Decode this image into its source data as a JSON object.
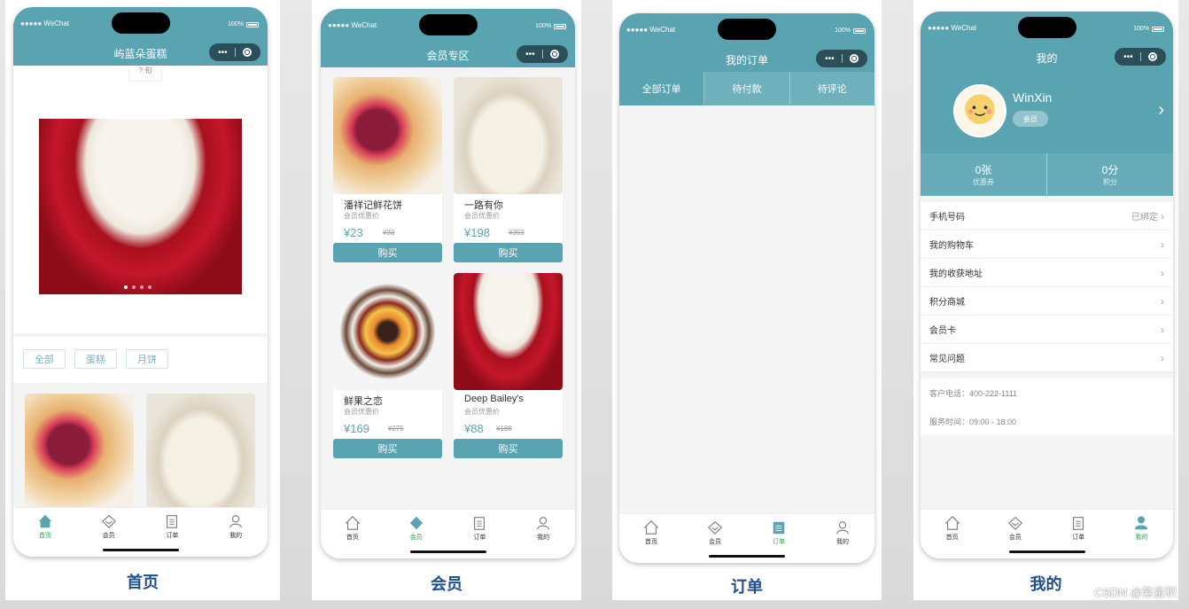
{
  "status": {
    "carrier": "●●●●● WeChat",
    "battery": "100%"
  },
  "tabs": {
    "home": "首页",
    "member": "会员",
    "order": "订单",
    "mine": "我的"
  },
  "home": {
    "title": "屿蓝朵蛋糕",
    "top_fragment": "? 旬",
    "filters": [
      "全部",
      "蛋糕",
      "月饼"
    ],
    "caption": "首页"
  },
  "member": {
    "title": "会员专区",
    "caption": "会员",
    "products": [
      {
        "name": "潘祥记鲜花饼",
        "sub": "会员优惠价",
        "price": "¥23",
        "orig": "¥33",
        "buy": "购买"
      },
      {
        "name": "一路有你",
        "sub": "会员优惠价",
        "price": "¥198",
        "orig": "¥359",
        "buy": "购买"
      },
      {
        "name": "鲜果之恋",
        "sub": "会员优惠价",
        "price": "¥169",
        "orig": "¥275",
        "buy": "购买"
      },
      {
        "name": "Deep Bailey's",
        "sub": "会员优惠价",
        "price": "¥88",
        "orig": "¥188",
        "buy": "购买"
      }
    ]
  },
  "order": {
    "title": "我的订单",
    "caption": "订单",
    "tabs": [
      "全部订单",
      "待付款",
      "待评论"
    ]
  },
  "mine": {
    "title": "我的",
    "caption": "我的",
    "username": "WinXin",
    "badge": "会员",
    "stats": [
      {
        "value": "0张",
        "label": "优惠券"
      },
      {
        "value": "0分",
        "label": "积分"
      }
    ],
    "menu": [
      {
        "label": "手机号码",
        "value": "已绑定"
      },
      {
        "label": "我的购物车",
        "value": ""
      },
      {
        "label": "我的收获地址",
        "value": ""
      },
      {
        "label": "积分商城",
        "value": ""
      },
      {
        "label": "会员卡",
        "value": ""
      },
      {
        "label": "常见问题",
        "value": ""
      }
    ],
    "phone": "客户电话：400-222-1111",
    "hours": "服务时间：09:00 - 18:00"
  },
  "watermark": "CSDN @繁星积",
  "colors": {
    "teal": "#5aa3b1",
    "active_tab": "#2aa84a",
    "caption": "#1f4e8c"
  }
}
